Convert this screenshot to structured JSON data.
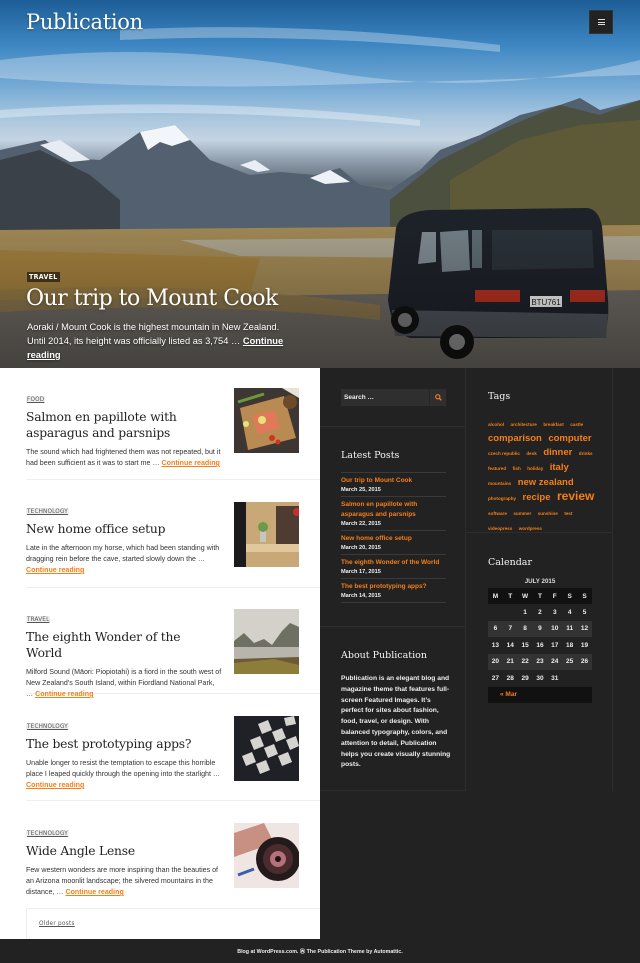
{
  "site": {
    "title": "Publication",
    "menu_icon": "hamburger-menu-icon"
  },
  "hero": {
    "category": "Travel",
    "title": "Our trip to Mount Cook",
    "excerpt": "Aoraki / Mount Cook is the highest mountain in New Zealand. Until 2014, its height was officially listed as 3,754 …",
    "continue_label": "Continue reading",
    "plate": "BTU761"
  },
  "posts": [
    {
      "category": "Food",
      "title": "Salmon en papillote with asparagus and parsnips",
      "excerpt": "The sound which had frightened them was not repeated, but it had been sufficient as it was to start me …",
      "continue_label": "Continue reading"
    },
    {
      "category": "Technology",
      "title": "New home office setup",
      "excerpt": "Late in the afternoon my horse, which had been standing with dragging rein before the cave, started slowly down the …",
      "continue_label": "Continue reading"
    },
    {
      "category": "Travel",
      "title": "The eighth Wonder of the World",
      "excerpt": "Milford Sound (Māori: Piopiotahi) is a fiord in the south west of New Zealand’s South Island, within Fiordland National Park, …",
      "continue_label": "Continue reading"
    },
    {
      "category": "Technology",
      "title": "The best prototyping apps?",
      "excerpt": "Unable longer to resist the temptation to escape this horrible place I leaped quickly through the opening into the starlight …",
      "continue_label": "Continue reading"
    },
    {
      "category": "Technology",
      "title": "Wide Angle Lense",
      "excerpt": "Few western wonders are more inspiring than the beauties of an Arizona moonlit landscape; the silvered mountains in the distance, …",
      "continue_label": "Continue reading"
    }
  ],
  "pagination": {
    "older_label": "Older posts"
  },
  "sidebar": {
    "search": {
      "placeholder": "Search …",
      "value": ""
    },
    "latest_posts": {
      "title": "Latest Posts",
      "items": [
        {
          "title": "Our trip to Mount Cook",
          "date": "March 25, 2015"
        },
        {
          "title": "Salmon en papillote with asparagus and parsnips",
          "date": "March 22, 2015"
        },
        {
          "title": "New home office setup",
          "date": "March 20, 2015"
        },
        {
          "title": "The eighth Wonder of the World",
          "date": "March 17, 2015"
        },
        {
          "title": "The best prototyping apps?",
          "date": "March 14, 2015"
        }
      ]
    },
    "about": {
      "title": "About Publication",
      "text": "Publication is an elegant blog and magazine theme that features full-screen Featured Images. It’s perfect for sites about fashion, food, travel, or design. With balanced typography, colors, and attention to detail, Publication helps you create visually stunning posts."
    },
    "tags": {
      "title": "Tags",
      "items": [
        {
          "label": "alcohol",
          "size": 1
        },
        {
          "label": "architecture",
          "size": 1
        },
        {
          "label": "breakfast",
          "size": 1
        },
        {
          "label": "castle",
          "size": 1
        },
        {
          "label": "comparison",
          "size": 3
        },
        {
          "label": "computer",
          "size": 3
        },
        {
          "label": "czech republic",
          "size": 1
        },
        {
          "label": "desk",
          "size": 1
        },
        {
          "label": "dinner",
          "size": 3
        },
        {
          "label": "drinks",
          "size": 1
        },
        {
          "label": "featured",
          "size": 1
        },
        {
          "label": "fish",
          "size": 1
        },
        {
          "label": "holiday",
          "size": 1
        },
        {
          "label": "italy",
          "size": 3
        },
        {
          "label": "mountains",
          "size": 1
        },
        {
          "label": "new zealand",
          "size": 3
        },
        {
          "label": "photography",
          "size": 1
        },
        {
          "label": "recipe",
          "size": 3
        },
        {
          "label": "review",
          "size": 4
        },
        {
          "label": "software",
          "size": 1
        },
        {
          "label": "summer",
          "size": 1
        },
        {
          "label": "sunshine",
          "size": 1
        },
        {
          "label": "test",
          "size": 1
        },
        {
          "label": "videopress",
          "size": 1
        },
        {
          "label": "wordpress",
          "size": 1
        }
      ]
    },
    "calendar": {
      "title": "Calendar",
      "caption": "JULY 2015",
      "weekdays": [
        "M",
        "T",
        "W",
        "T",
        "F",
        "S",
        "S"
      ],
      "weeks": [
        [
          "",
          "",
          "1",
          "2",
          "3",
          "4",
          "5"
        ],
        [
          "6",
          "7",
          "8",
          "9",
          "10",
          "11",
          "12"
        ],
        [
          "13",
          "14",
          "15",
          "16",
          "17",
          "18",
          "19"
        ],
        [
          "20",
          "21",
          "22",
          "23",
          "24",
          "25",
          "26"
        ],
        [
          "27",
          "28",
          "29",
          "30",
          "31",
          "",
          ""
        ]
      ],
      "prev_label": "« Mar"
    }
  },
  "footer": {
    "blog_at": "Blog at WordPress.com.",
    "theme": "The Publication Theme",
    "by": "by",
    "author": "Automattic."
  },
  "colors": {
    "accent": "#f57f17",
    "sidebar_bg": "#222222",
    "main_bg": "#ffffff"
  }
}
